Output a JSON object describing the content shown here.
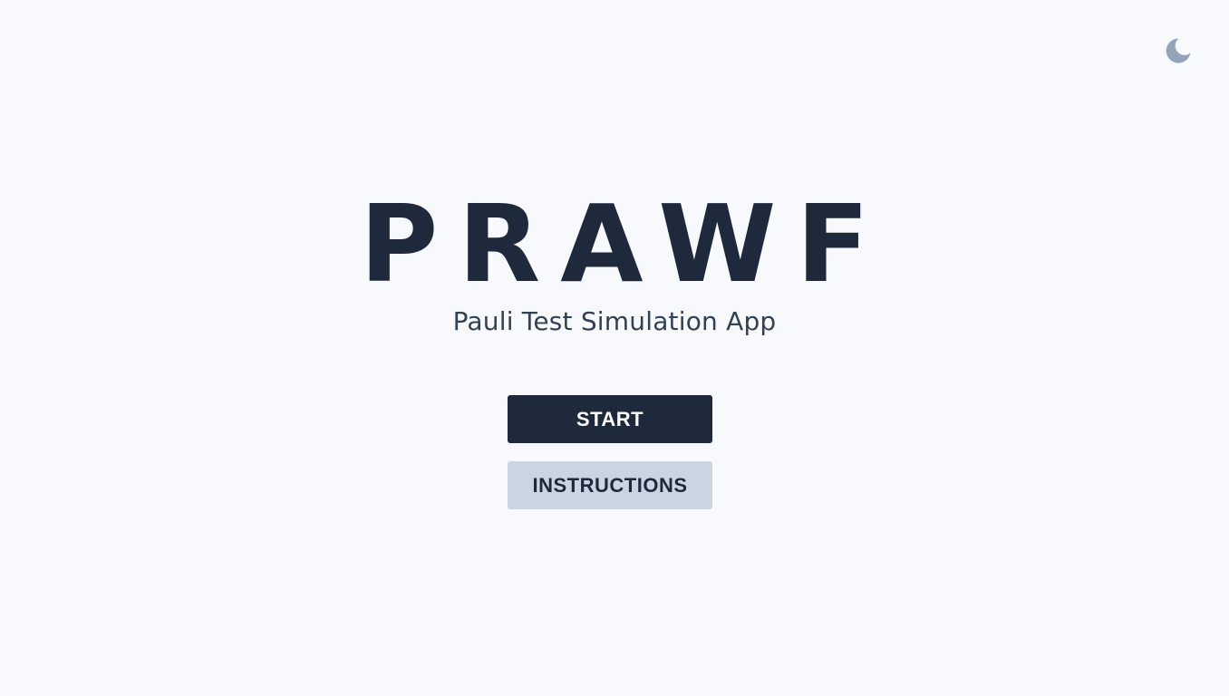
{
  "theme_toggle": {
    "icon": "moon-icon",
    "color": "#94a3b8"
  },
  "hero": {
    "title": "PRAWF",
    "subtitle": "Pauli Test Simulation App"
  },
  "actions": {
    "start_label": "START",
    "instructions_label": "INSTRUCTIONS"
  },
  "colors": {
    "background": "#f7f9fc",
    "primary": "#1e293b",
    "secondary": "#cbd5e1"
  }
}
